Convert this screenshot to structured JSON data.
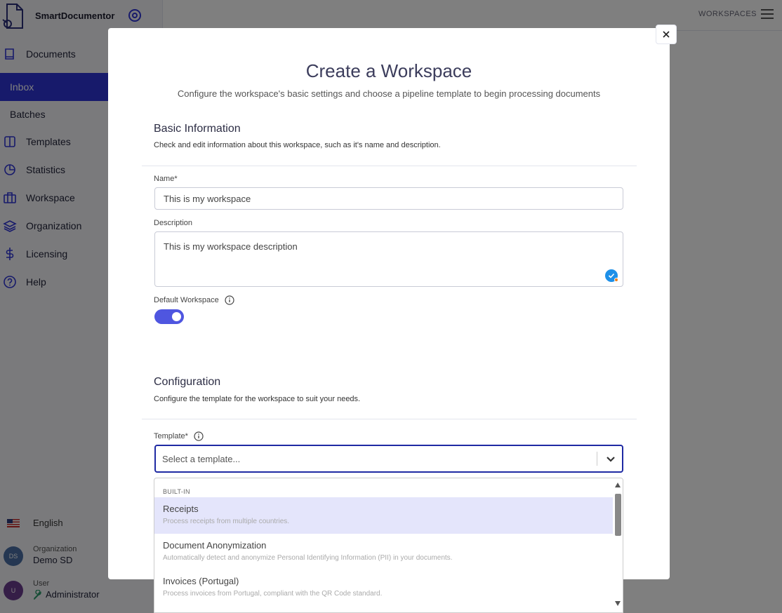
{
  "app": {
    "brand_name": "SmartDocumentor",
    "workspaces_label": "WORKSPACES"
  },
  "sidebar": {
    "items": [
      {
        "label": "Documents",
        "icon": "book-icon"
      },
      {
        "label": "Inbox",
        "active": true
      },
      {
        "label": "Batches"
      },
      {
        "label": "Templates",
        "icon": "columns-icon"
      },
      {
        "label": "Statistics",
        "icon": "pie-chart-icon"
      },
      {
        "label": "Workspace",
        "icon": "briefcase-icon"
      },
      {
        "label": "Organization",
        "icon": "layers-icon"
      },
      {
        "label": "Licensing",
        "icon": "dollar-icon"
      },
      {
        "label": "Help",
        "icon": "help-circle-icon"
      }
    ],
    "language": "English",
    "organization": {
      "caption": "Organization",
      "name": "Demo SD",
      "initials": "DS"
    },
    "user": {
      "caption": "User",
      "name": "Administrator",
      "initials": "U"
    }
  },
  "modal": {
    "title": "Create a Workspace",
    "subtitle": "Configure the workspace's basic settings and choose a pipeline template to begin processing documents",
    "basic": {
      "title": "Basic Information",
      "desc": "Check and edit information about this workspace, such as it's name and description.",
      "name_label": "Name*",
      "name_value": "This is my workspace",
      "description_label": "Description",
      "description_value": "This is my workspace description",
      "default_label": "Default Workspace",
      "default_on": true
    },
    "config": {
      "title": "Configuration",
      "desc": "Configure the template for the workspace to suit your needs.",
      "template_label": "Template*",
      "template_placeholder": "Select a template..."
    }
  },
  "dropdown": {
    "group": "BUILT-IN",
    "options": [
      {
        "title": "Receipts",
        "desc": "Process receipts from multiple countries.",
        "selected": true
      },
      {
        "title": "Document Anonymization",
        "desc": "Automatically detect and anonymize Personal Identifying Information (PII) in your documents."
      },
      {
        "title": "Invoices (Portugal)",
        "desc": "Process invoices from Portugal, compliant with the QR Code standard."
      }
    ]
  },
  "colors": {
    "accent": "#2f35d6",
    "toggle": "#4f56e0",
    "select_border": "#1f2aa3",
    "org_avatar": "#4a6fa5",
    "user_avatar": "#6a3d8f"
  }
}
